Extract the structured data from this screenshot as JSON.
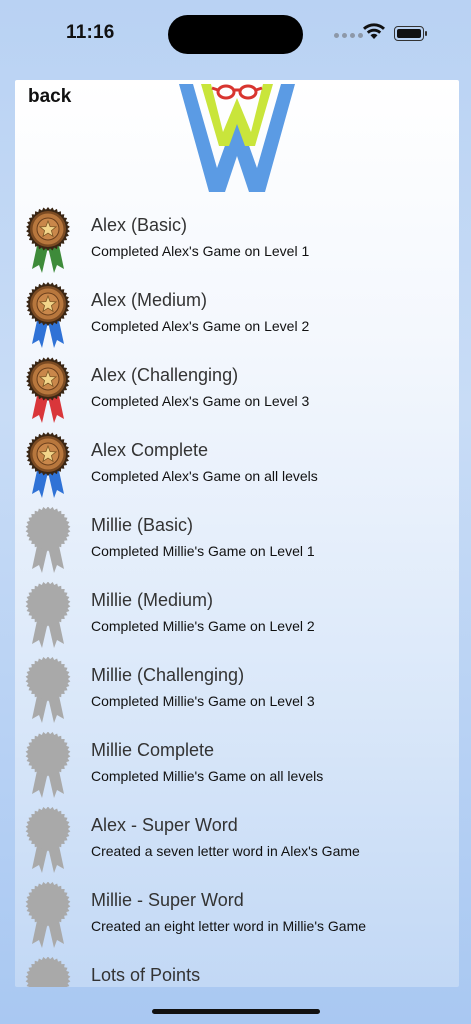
{
  "status": {
    "time": "11:16",
    "icons": [
      "signal-dots-icon",
      "wifi-icon",
      "battery-icon"
    ]
  },
  "header": {
    "back_label": "back",
    "logo_icon": "w-glasses-logo"
  },
  "colors": {
    "bronze": "#b8773d",
    "bronze_dark": "#7a4a22",
    "locked_gray": "#a9a9a9",
    "ribbon_green": "#3e8b3a",
    "ribbon_blue": "#2f72d6",
    "ribbon_red": "#d9363a",
    "logo_blue": "#5b9be4",
    "logo_lime": "#c9e53b",
    "logo_red": "#d8352f"
  },
  "achievements": [
    {
      "title": "Alex (Basic)",
      "description": "Completed Alex's Game on Level 1",
      "earned": true,
      "ribbon": "green"
    },
    {
      "title": "Alex (Medium)",
      "description": "Completed Alex's Game on Level 2",
      "earned": true,
      "ribbon": "blue"
    },
    {
      "title": "Alex (Challenging)",
      "description": "Completed Alex's Game on Level 3",
      "earned": true,
      "ribbon": "red"
    },
    {
      "title": "Alex Complete",
      "description": "Completed Alex's Game on all levels",
      "earned": true,
      "ribbon": "blue"
    },
    {
      "title": "Millie (Basic)",
      "description": "Completed Millie's Game on Level 1",
      "earned": false
    },
    {
      "title": "Millie (Medium)",
      "description": "Completed Millie's Game on Level 2",
      "earned": false
    },
    {
      "title": "Millie (Challenging)",
      "description": "Completed Millie's Game on Level 3",
      "earned": false
    },
    {
      "title": "Millie Complete",
      "description": "Completed Millie's Game on all levels",
      "earned": false
    },
    {
      "title": "Alex - Super Word",
      "description": "Created a seven letter word in Alex's Game",
      "earned": false
    },
    {
      "title": "Millie - Super Word",
      "description": "Created an eight letter word in Millie's Game",
      "earned": false
    },
    {
      "title": "Lots of Points",
      "description": "",
      "earned": false
    }
  ]
}
